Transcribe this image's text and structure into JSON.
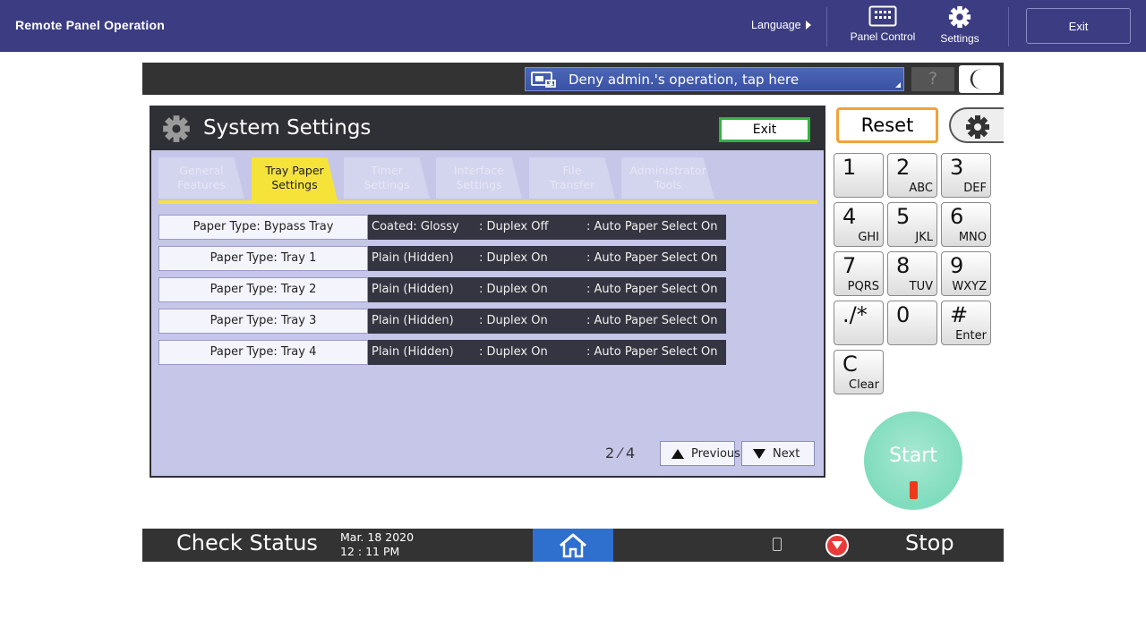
{
  "topbar": {
    "title": "Remote Panel Operation",
    "language": "Language",
    "panel_control": "Panel Control",
    "settings": "Settings",
    "exit": "Exit"
  },
  "panel": {
    "deny_admin": "Deny admin.'s operation, tap here",
    "help": "?",
    "system": {
      "title": "System Settings",
      "exit": "Exit",
      "tabs": [
        {
          "line1": "General",
          "line2": "Features",
          "active": false
        },
        {
          "line1": "Tray Paper",
          "line2": "Settings",
          "active": true
        },
        {
          "line1": "Timer",
          "line2": "Settings",
          "active": false
        },
        {
          "line1": "Interface",
          "line2": "Settings",
          "active": false
        },
        {
          "line1": "File",
          "line2": "Transfer",
          "active": false
        },
        {
          "line1": "Administrator",
          "line2": "Tools",
          "active": false
        }
      ],
      "rows": [
        {
          "label": "Paper Type: Bypass Tray",
          "type": "Coated: Glossy",
          "duplex": ": Duplex Off",
          "auto": ": Auto Paper Select On"
        },
        {
          "label": "Paper Type: Tray 1",
          "type": "Plain (Hidden)",
          "duplex": ": Duplex On",
          "auto": ": Auto Paper Select On"
        },
        {
          "label": "Paper Type: Tray 2",
          "type": "Plain (Hidden)",
          "duplex": ": Duplex On",
          "auto": ": Auto Paper Select On"
        },
        {
          "label": "Paper Type: Tray 3",
          "type": "Plain (Hidden)",
          "duplex": ": Duplex On",
          "auto": ": Auto Paper Select On"
        },
        {
          "label": "Paper Type: Tray 4",
          "type": "Plain (Hidden)",
          "duplex": ": Duplex On",
          "auto": ": Auto Paper Select On"
        }
      ],
      "page": "2 ⁄ 4",
      "previous": "Previous",
      "next": "Next"
    },
    "keypad": {
      "reset": "Reset",
      "keys": [
        {
          "num": "1",
          "sub": ""
        },
        {
          "num": "2",
          "sub": "ABC"
        },
        {
          "num": "3",
          "sub": "DEF"
        },
        {
          "num": "4",
          "sub": "GHI"
        },
        {
          "num": "5",
          "sub": "JKL"
        },
        {
          "num": "6",
          "sub": "MNO"
        },
        {
          "num": "7",
          "sub": "PQRS"
        },
        {
          "num": "8",
          "sub": "TUV"
        },
        {
          "num": "9",
          "sub": "WXYZ"
        },
        {
          "num": "./*",
          "sub": ""
        },
        {
          "num": "0",
          "sub": ""
        },
        {
          "num": "#",
          "sub": "Enter"
        },
        {
          "num": "C",
          "sub": "Clear"
        }
      ],
      "start": "Start"
    },
    "status": {
      "check_status": "Check Status",
      "date": "Mar. 18 2020",
      "time": "12 : 11 PM",
      "stop": "Stop"
    }
  }
}
